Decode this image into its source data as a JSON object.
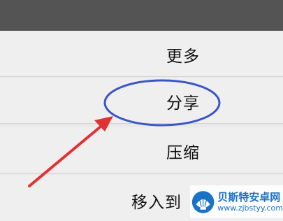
{
  "menu": {
    "items": [
      {
        "label": "更多"
      },
      {
        "label": "分享"
      },
      {
        "label": "压缩"
      },
      {
        "label": "移入到"
      }
    ]
  },
  "annotation": {
    "circle_color": "#3b55c9",
    "arrow_color": "#e03232",
    "highlighted_item": "分享"
  },
  "watermark": {
    "name": "贝斯特安卓网",
    "url": "www.zjbstyy.com",
    "color": "#1a73c7"
  }
}
